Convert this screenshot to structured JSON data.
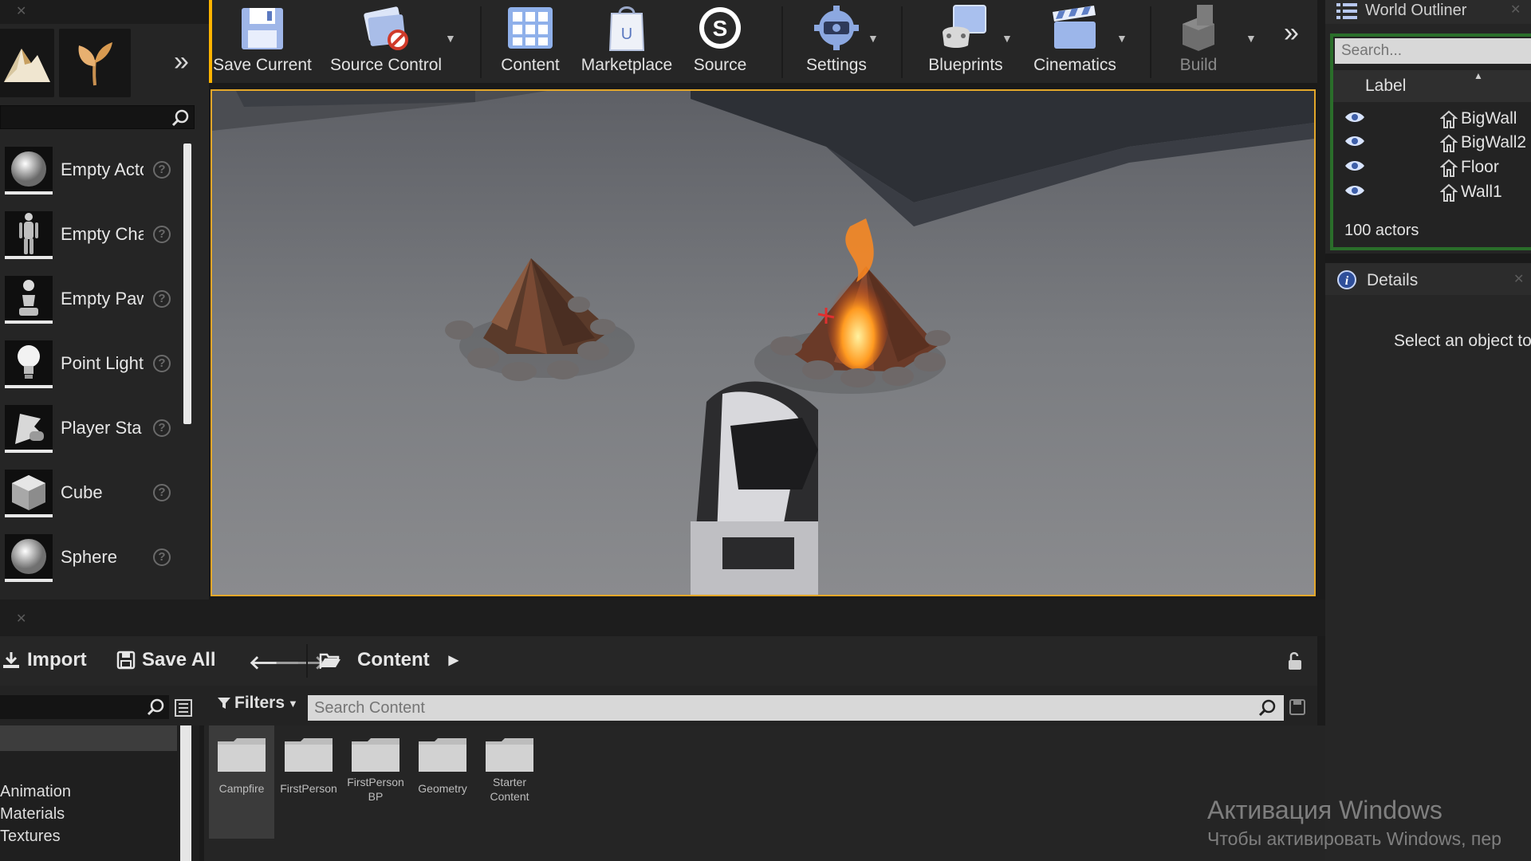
{
  "modes_panel": {
    "items": [
      {
        "label": "Empty Acto",
        "icon": "sphere-actor-icon"
      },
      {
        "label": "Empty Cha",
        "icon": "character-icon"
      },
      {
        "label": "Empty Paw",
        "icon": "pawn-icon"
      },
      {
        "label": "Point Light",
        "icon": "light-bulb-icon"
      },
      {
        "label": "Player Sta",
        "icon": "player-start-icon"
      },
      {
        "label": "Cube",
        "icon": "cube-icon"
      },
      {
        "label": "Sphere",
        "icon": "sphere-icon"
      }
    ],
    "help_glyph": "?"
  },
  "toolbar": {
    "save_current": "Save Current",
    "source_control": "Source Control",
    "content": "Content",
    "marketplace": "Marketplace",
    "source": "Source",
    "settings": "Settings",
    "blueprints": "Blueprints",
    "cinematics": "Cinematics",
    "build": "Build"
  },
  "world_outliner": {
    "title": "World Outliner",
    "search_placeholder": "Search...",
    "column_label": "Label",
    "rows": [
      "BigWall",
      "BigWall2",
      "Floor",
      "Wall1"
    ],
    "actor_count": "100 actors"
  },
  "details": {
    "title": "Details",
    "hint": "Select an object to"
  },
  "content_browser": {
    "import_label": "Import",
    "save_all_label": "Save All",
    "path_label": "Content",
    "filters_label": "Filters",
    "search_placeholder": "Search Content",
    "tree_items": [
      "Animation",
      "Materials",
      "Textures"
    ],
    "assets": [
      {
        "name": "Campfire"
      },
      {
        "name": "FirstPerson"
      },
      {
        "name": "FirstPerson BP"
      },
      {
        "name": "Geometry"
      },
      {
        "name": "Starter Content"
      }
    ]
  },
  "watermark": {
    "line1": "Активация Windows",
    "line2": "Чтобы активировать Windows, пер"
  },
  "colors": {
    "viewport_border": "#e3a72a",
    "outliner_focus": "#2a6e2a",
    "panel_bg": "#252525"
  }
}
